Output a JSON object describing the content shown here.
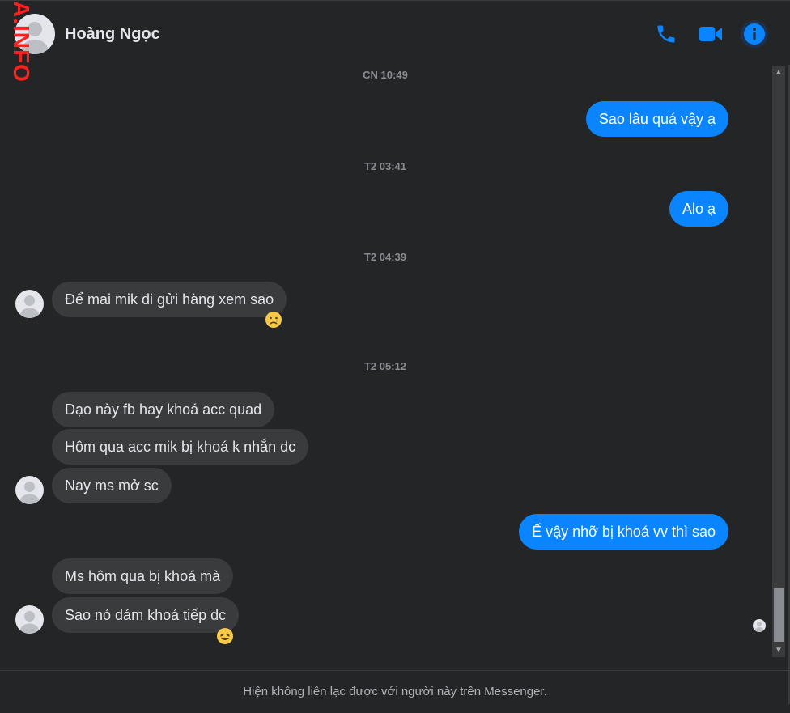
{
  "header": {
    "name": "Hoàng Ngọc",
    "watermark": "A.INFO",
    "icons": [
      "phone-icon",
      "video-camera-icon",
      "info-icon"
    ]
  },
  "colors": {
    "accent": "#0a84ff",
    "background": "#242526",
    "incoming_bubble": "#3a3b3c"
  },
  "messages": {
    "ts1": "CN 10:49",
    "m1": "Sao lâu quá vậy ạ",
    "ts2": "T2 03:41",
    "m2": "Alo ạ",
    "ts3": "T2 04:39",
    "m3": "Để mai mik đi gửi hàng xem sao",
    "ts4": "T2 05:12",
    "m4": "Dạo này fb hay khoá acc quad",
    "m5": "Hôm qua acc mik bị khoá k nhắn dc",
    "m6": "Nay ms mở sc",
    "m7": "Ế vậy nhỡ bị khoá vv thì sao",
    "m8": "Ms hôm qua bị khoá mà",
    "m9": "Sao nó dám khoá tiếp dc"
  },
  "reactions": {
    "m3": "sad-face-emoji",
    "m9": "laughing-emoji"
  },
  "footer": {
    "notice": "Hiện không liên lạc được với người này trên Messenger."
  }
}
